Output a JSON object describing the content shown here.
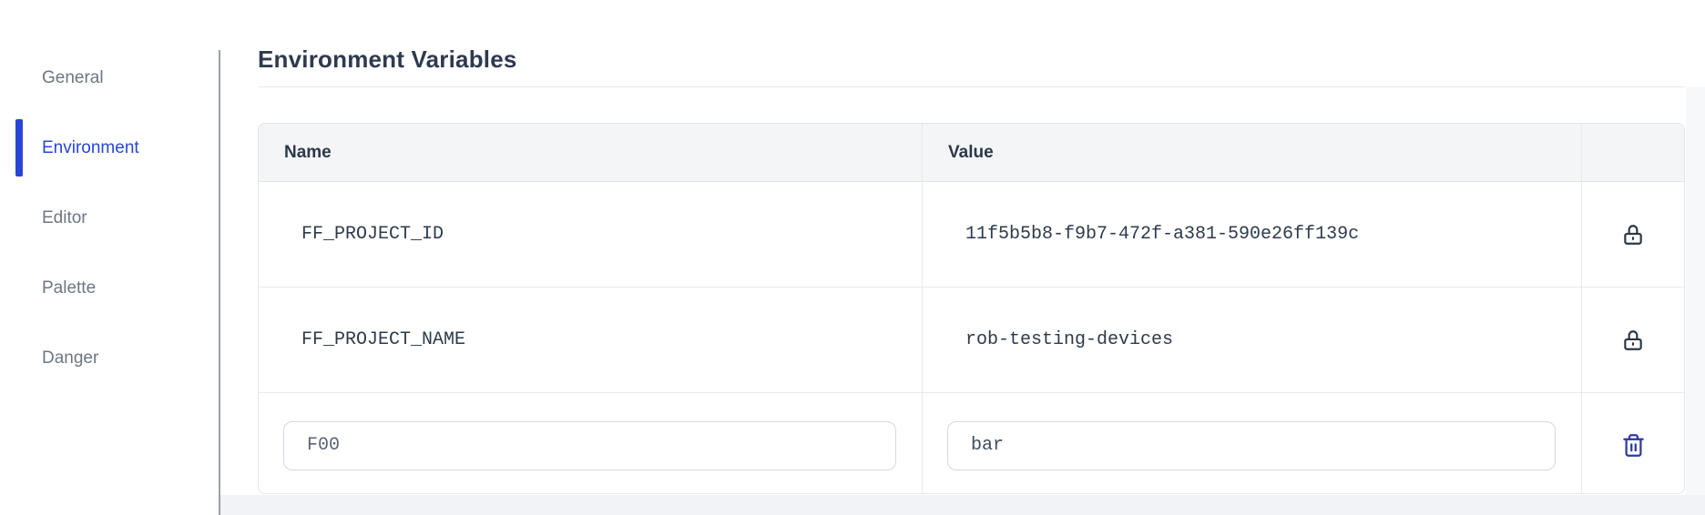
{
  "sidebar": {
    "items": [
      {
        "label": "General",
        "active": false
      },
      {
        "label": "Environment",
        "active": true
      },
      {
        "label": "Editor",
        "active": false
      },
      {
        "label": "Palette",
        "active": false
      },
      {
        "label": "Danger",
        "active": false
      }
    ]
  },
  "main": {
    "title": "Environment Variables",
    "table": {
      "columns": {
        "name": "Name",
        "value": "Value",
        "actions": ""
      },
      "rows": [
        {
          "name": "FF_PROJECT_ID",
          "value": "11f5b5b8-f9b7-472f-a381-590e26ff139c",
          "locked": true
        },
        {
          "name": "FF_PROJECT_NAME",
          "value": "rob-testing-devices",
          "locked": true
        }
      ],
      "editable_row": {
        "name": "F00",
        "value": "bar"
      }
    }
  },
  "colors": {
    "accent_blue": "#2746d6",
    "sidebar_text": "#6e7683",
    "title_text": "#2e3a4e",
    "mono_text": "#2e3a4a",
    "table_border": "#e3e6ea",
    "header_bg": "#f4f5f7",
    "lock_icon": "#2b3645",
    "trash_icon": "#2c3b9e"
  }
}
